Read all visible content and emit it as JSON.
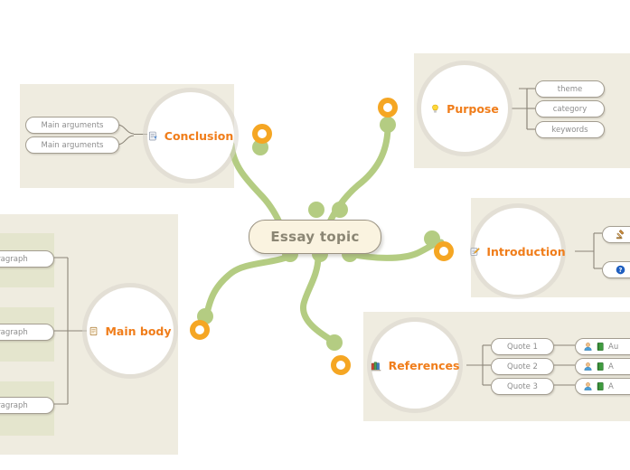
{
  "mindmap": {
    "center": {
      "label": "Essay topic"
    },
    "topics": [
      {
        "id": "conclusion",
        "label": "Conclusion",
        "icon": "document-icon",
        "children": [
          {
            "label": "Main arguments"
          },
          {
            "label": "Main arguments"
          }
        ]
      },
      {
        "id": "purpose",
        "label": "Purpose",
        "icon": "lightbulb-icon",
        "children": [
          {
            "label": "theme"
          },
          {
            "label": "category"
          },
          {
            "label": "keywords"
          }
        ]
      },
      {
        "id": "introduction",
        "label": "Introduction",
        "icon": "pencil-note-icon",
        "children": [
          {
            "label": "",
            "icon": "gavel-icon"
          },
          {
            "label": "",
            "icon": "question-mark-icon"
          }
        ]
      },
      {
        "id": "main-body",
        "label": "Main body",
        "icon": "notepad-icon",
        "children": [
          {
            "label": "Paragraph"
          },
          {
            "label": "Paragraph"
          },
          {
            "label": "Paragraph"
          }
        ]
      },
      {
        "id": "references",
        "label": "References",
        "icon": "books-icon",
        "children": [
          {
            "label": "Quote 1",
            "grandchild": {
              "label": "Au",
              "icons": [
                "person-icon",
                "green-book-icon"
              ]
            }
          },
          {
            "label": "Quote 2",
            "grandchild": {
              "label": "A",
              "icons": [
                "person-icon",
                "green-book-icon"
              ]
            }
          },
          {
            "label": "Quote 3",
            "grandchild": {
              "label": "A",
              "icons": [
                "person-icon",
                "green-book-icon"
              ]
            }
          }
        ]
      }
    ],
    "colors": {
      "branch_green": "#b4cc82",
      "marker_orange": "#f5a623",
      "topic_orange": "#f07d1a",
      "panel_beige": "#efece0",
      "subpanel_green": "#e4e5cd",
      "center_fill": "#faf3e0",
      "center_text": "#8b8674",
      "pill_text": "#8d8d8d"
    }
  }
}
